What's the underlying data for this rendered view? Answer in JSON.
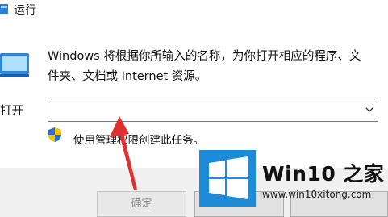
{
  "window": {
    "title": "运行",
    "description": "Windows 将根据你所输入的名称，为你打开相应的程序、文件夹、文档或 Internet 资源。",
    "open_label": "打开",
    "open_value": "",
    "admin_note": "使用管理权限创建此任务。"
  },
  "buttons": {
    "ok_label": "确定",
    "cancel_label": "",
    "browse_label": ""
  },
  "watermark": {
    "title": "Win10 之家",
    "url": "www.win10xitong.com"
  },
  "icons": [
    "run-app-icon",
    "run-dialog-icon",
    "chevron-down-icon",
    "uac-shield-icon",
    "red-arrow-annotation",
    "windows-logo-icon"
  ],
  "colors": {
    "accent_red": "#e03030",
    "windows_blue": "#1d8bd8"
  }
}
